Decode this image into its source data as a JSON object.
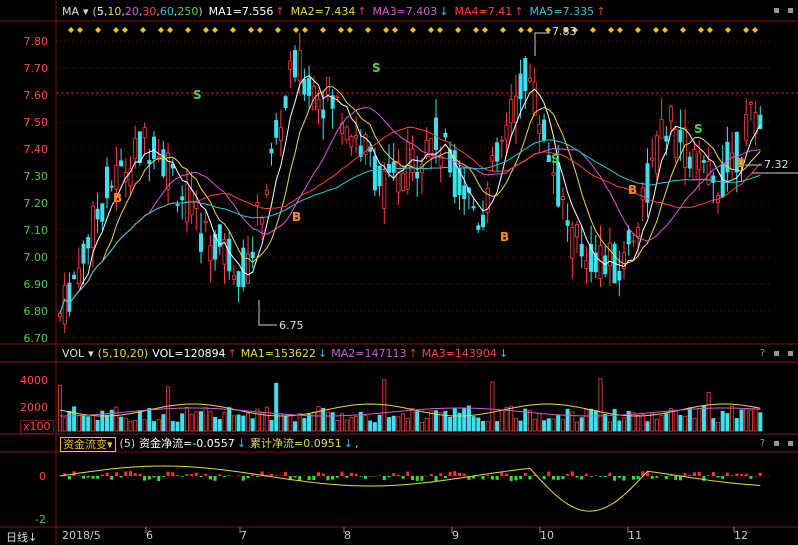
{
  "main_panel": {
    "ma_menu": "MA",
    "params_open": "(",
    "params": [
      "5",
      "10",
      "20",
      "30",
      "60",
      "250"
    ],
    "params_close": ")",
    "ma1": "MA1=7.556",
    "ma2": "MA2=7.434",
    "ma3": "MA3=7.403",
    "ma4": "MA4=7.41",
    "ma5": "MA5=7.335",
    "y_ticks": [
      "7.80",
      "7.70",
      "7.60",
      "7.50",
      "7.40",
      "7.30",
      "7.20",
      "7.10",
      "7.00",
      "6.90",
      "6.80",
      "6.70"
    ],
    "high_label": "7.83",
    "low_label": "6.75",
    "last_label": "7.32",
    "buy_marker": "B",
    "sell_marker": "S"
  },
  "vol_panel": {
    "menu": "VOL",
    "params": "(5,10,20)",
    "vol": "VOL=120894",
    "ma1": "MA1=153622",
    "ma2": "MA2=147113",
    "ma3": "MA3=143904",
    "y_ticks": [
      "4000",
      "2000"
    ],
    "unit": "x100"
  },
  "flow_panel": {
    "menu": "资金流变",
    "param": "(5)",
    "net": "资金净流=-0.0557",
    "cum": "累计净流=0.0951",
    "comma": ",",
    "y_ticks": [
      "0",
      "-2"
    ]
  },
  "footer": {
    "period": "日线",
    "dates": [
      "2018/5",
      "6",
      "7",
      "8",
      "9",
      "10",
      "11",
      "12"
    ]
  },
  "colors": {
    "up": "#ff3b3b",
    "down": "#3fe0ee",
    "ma1": "#ffffff",
    "ma2": "#e8d84a",
    "ma3": "#d65ad6",
    "ma4": "#ff4040",
    "ma5": "#35c4d6",
    "grid": "#7a1414"
  }
}
